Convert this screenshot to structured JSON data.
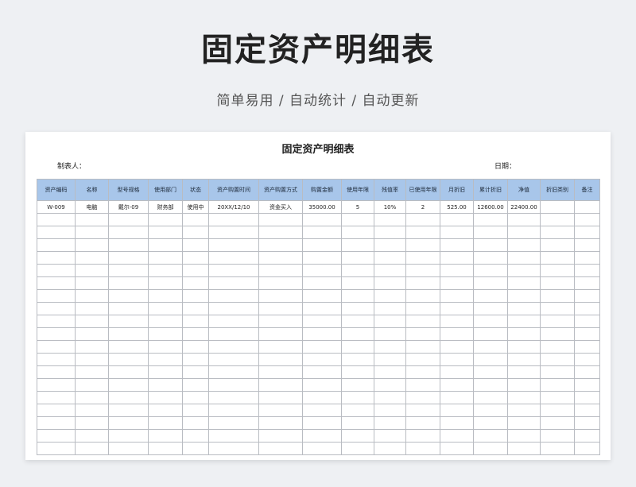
{
  "header": {
    "title": "固定资产明细表",
    "subtitle": "简单易用  /  自动统计  /  自动更新"
  },
  "sheet": {
    "title": "固定资产明细表",
    "preparer_label": "制表人：",
    "date_label": "日期：",
    "columns": [
      "资产编码",
      "名称",
      "型号规格",
      "使用部门",
      "状态",
      "资产购置时间",
      "资产购置方式",
      "购置金额",
      "使用年限",
      "残值率",
      "已使用年限",
      "月折旧",
      "累计折旧",
      "净值",
      "折旧类别",
      "备注"
    ],
    "rows": [
      [
        "W-009",
        "电脑",
        "戴尔-09",
        "财务部",
        "使用中",
        "20XX/12/10",
        "资金买入",
        "35000.00",
        "5",
        "10%",
        "2",
        "525.00",
        "12600.00",
        "22400.00",
        "",
        ""
      ]
    ]
  }
}
